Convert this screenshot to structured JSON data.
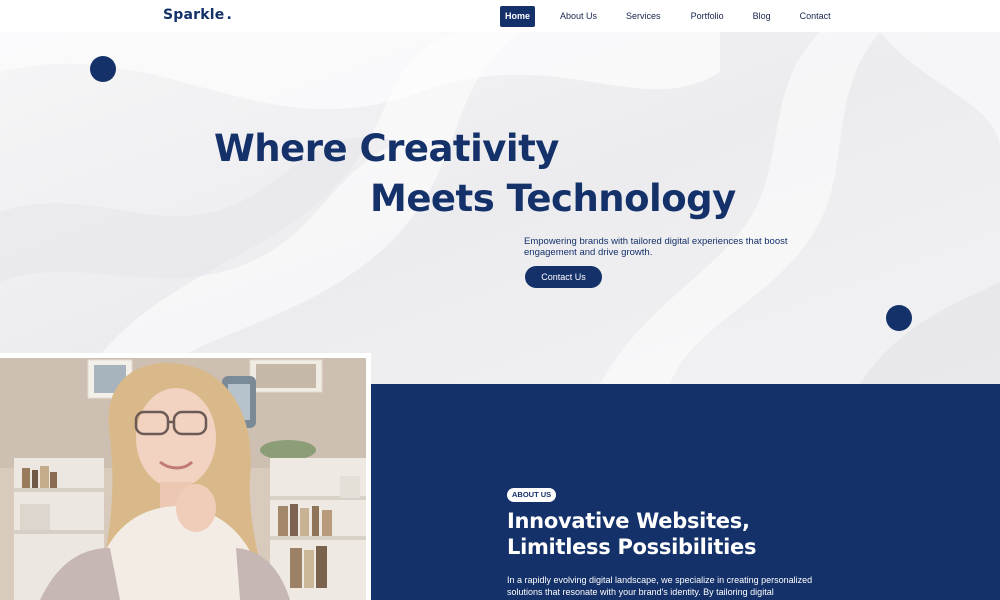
{
  "header": {
    "logo": "Sparkle",
    "logo_dot": ".",
    "nav": [
      {
        "label": "Home",
        "active": true
      },
      {
        "label": "About Us",
        "active": false
      },
      {
        "label": "Services",
        "active": false
      },
      {
        "label": "Portfolio",
        "active": false
      },
      {
        "label": "Blog",
        "active": false
      },
      {
        "label": "Contact",
        "active": false
      }
    ]
  },
  "hero": {
    "title_line1": "Where Creativity",
    "title_line2": "Meets Technology",
    "subtitle": "Empowering brands with tailored digital experiences that boost engagement and drive growth.",
    "cta_label": "Contact Us"
  },
  "about": {
    "badge": "ABOUT US",
    "title_line1": "Innovative Websites,",
    "title_line2": "Limitless Possibilities",
    "text": "In a rapidly evolving digital landscape, we specialize in creating personalized solutions that resonate with your brand's identity. By tailoring digital"
  },
  "colors": {
    "brand_navy": "#14316a",
    "hero_background": "#f1f1f3",
    "header_background": "#ffffff"
  }
}
